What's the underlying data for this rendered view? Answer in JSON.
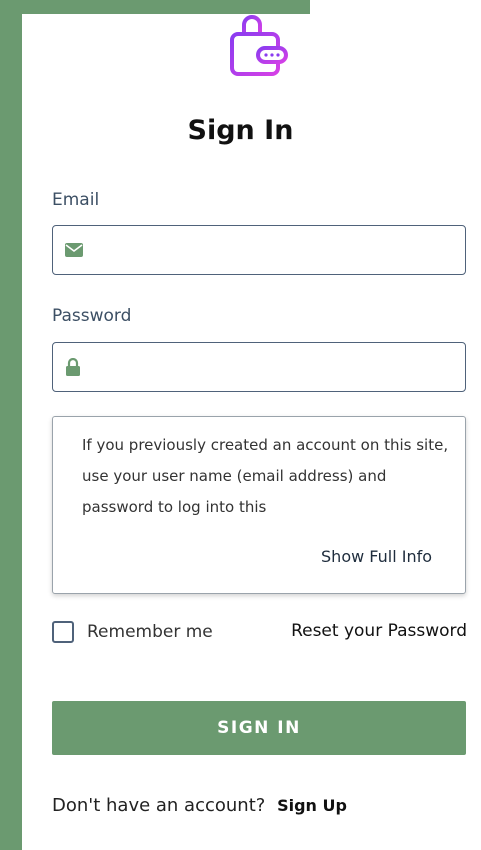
{
  "colors": {
    "brand_green": "#6b9a70",
    "icon_purple": "#8a3cf0",
    "icon_pink": "#d640e6",
    "border": "#4f627a",
    "label": "#3c4f64"
  },
  "page": {
    "title": "Sign In"
  },
  "email": {
    "label": "Email",
    "icon": "envelope-icon",
    "value": "",
    "placeholder": ""
  },
  "password": {
    "label": "Password",
    "icon": "lock-icon",
    "value": "",
    "placeholder": ""
  },
  "info": {
    "text": "If you previously created an account on this site, use your user name (email address) and password to log into this",
    "show_full_label": "Show Full Info"
  },
  "remember": {
    "label": "Remember me",
    "checked": false
  },
  "reset": {
    "label": "Reset your Password"
  },
  "submit": {
    "label": "SIGN IN"
  },
  "signup": {
    "prompt": "Don't have an account?",
    "link_label": "Sign Up"
  }
}
